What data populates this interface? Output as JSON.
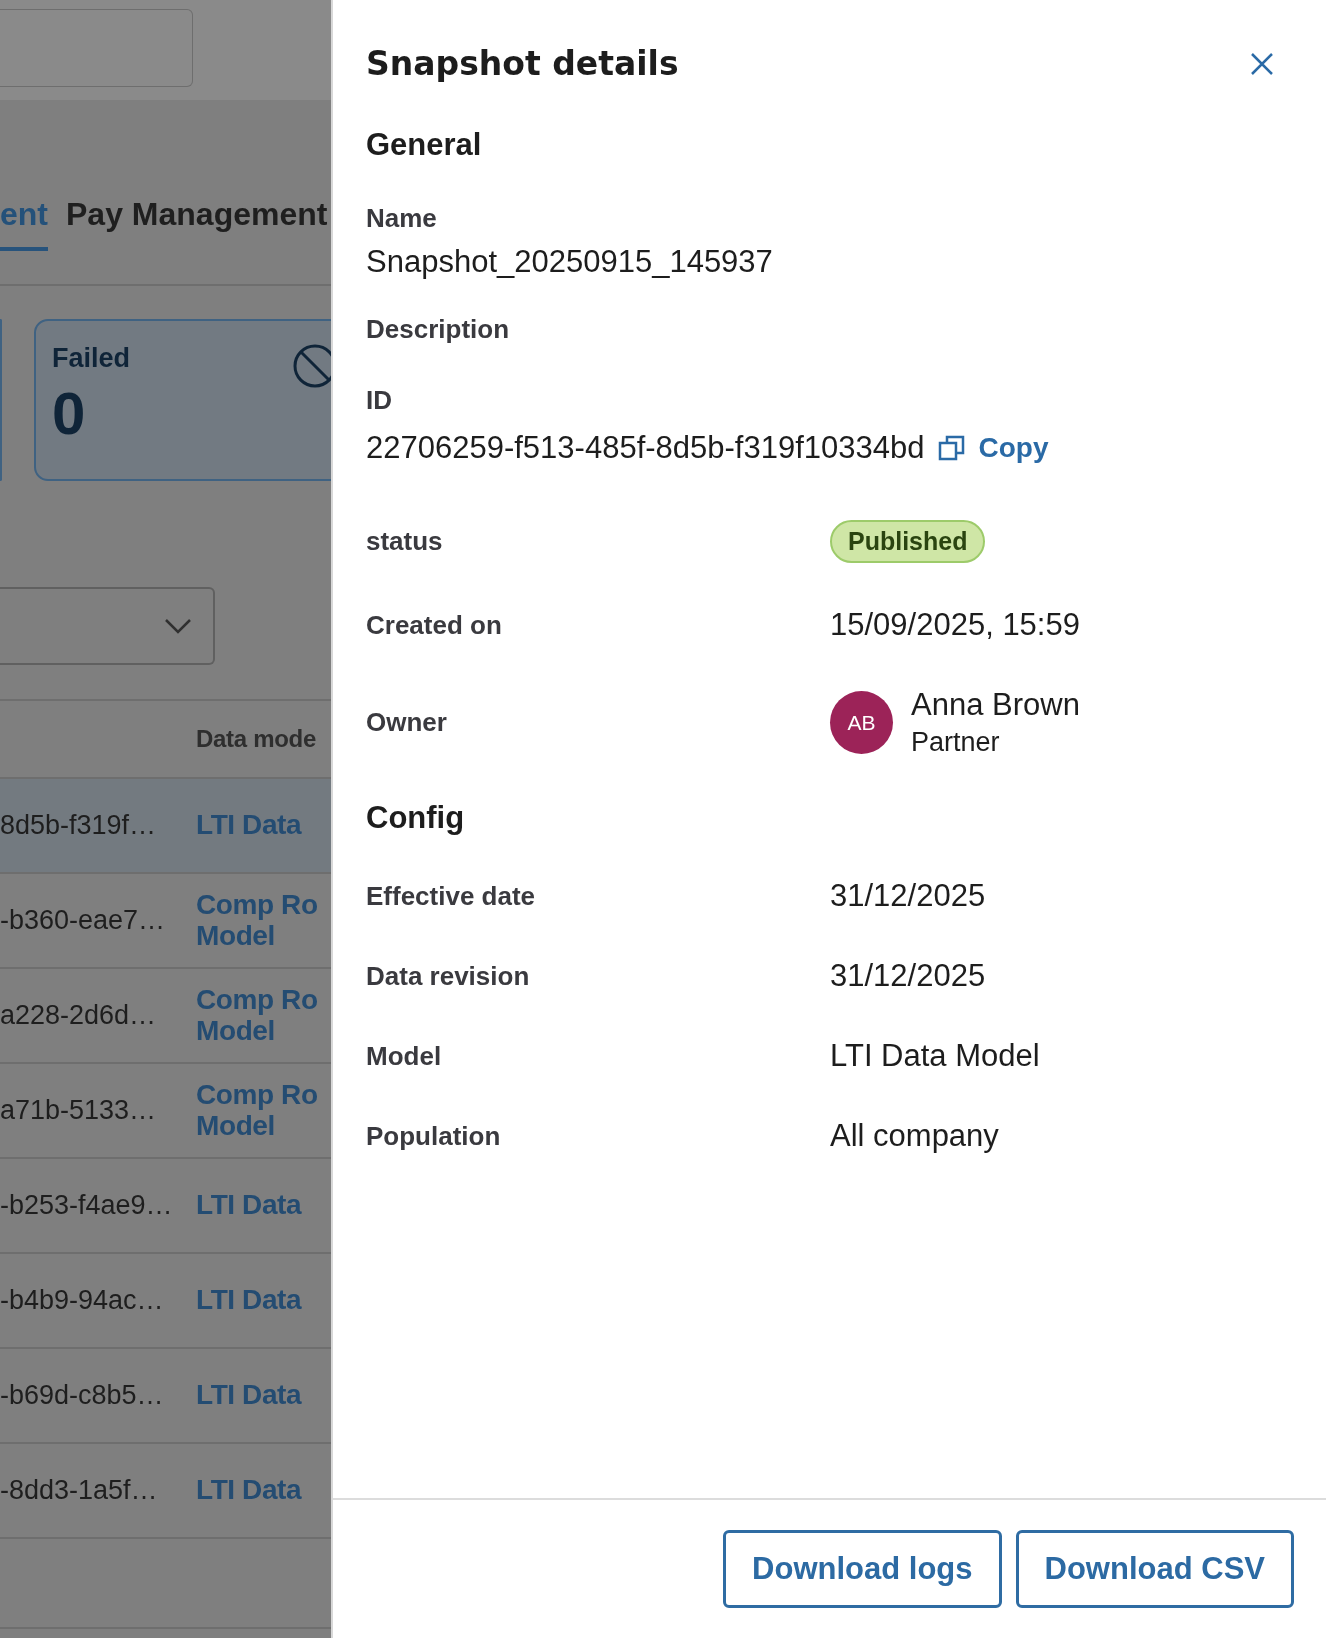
{
  "background": {
    "tabs": [
      {
        "label": "ent",
        "selected": true
      },
      {
        "label": "Pay Management",
        "selected": false
      }
    ],
    "card": {
      "label": "Failed",
      "value": "0"
    },
    "table": {
      "columns": [
        "Data mode"
      ],
      "rows": [
        {
          "id": "8d5b-f319f…",
          "model": [
            "LTI Data"
          ],
          "selected": true
        },
        {
          "id": "-b360-eae7…",
          "model": [
            "Comp Ro",
            "Model"
          ],
          "selected": false
        },
        {
          "id": "a228-2d6d…",
          "model": [
            "Comp Ro",
            "Model"
          ],
          "selected": false
        },
        {
          "id": "a71b-5133…",
          "model": [
            "Comp Ro",
            "Model"
          ],
          "selected": false
        },
        {
          "id": "-b253-f4ae9…",
          "model": [
            "LTI Data"
          ],
          "selected": false
        },
        {
          "id": "-b4b9-94ac…",
          "model": [
            "LTI Data"
          ],
          "selected": false
        },
        {
          "id": "-b69d-c8b5…",
          "model": [
            "LTI Data"
          ],
          "selected": false
        },
        {
          "id": "-8dd3-1a5f…",
          "model": [
            "LTI Data"
          ],
          "selected": false
        }
      ]
    }
  },
  "panel": {
    "title": "Snapshot details",
    "general": {
      "heading": "General",
      "name": {
        "label": "Name",
        "value": "Snapshot_20250915_145937"
      },
      "description": {
        "label": "Description"
      },
      "id": {
        "label": "ID",
        "value": "22706259-f513-485f-8d5b-f319f10334bd",
        "copy": "Copy"
      },
      "status": {
        "label": "status",
        "value": "Published"
      },
      "created": {
        "label": "Created on",
        "value": "15/09/2025, 15:59"
      },
      "owner": {
        "label": "Owner",
        "initials": "AB",
        "name": "Anna Brown",
        "role": "Partner",
        "color": "#9c2358"
      }
    },
    "config": {
      "heading": "Config",
      "rows": [
        {
          "label": "Effective date",
          "value": "31/12/2025"
        },
        {
          "label": "Data revision",
          "value": "31/12/2025"
        },
        {
          "label": "Model",
          "value": "LTI Data Model"
        },
        {
          "label": "Population",
          "value": "All company"
        }
      ]
    },
    "buttons": [
      "Download logs",
      "Download CSV"
    ]
  }
}
